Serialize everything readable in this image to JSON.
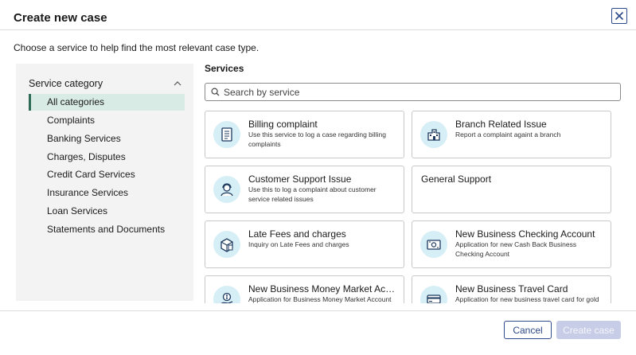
{
  "dialog": {
    "title": "Create new case",
    "subtitle": "Choose a service to help find the most relevant case type."
  },
  "sidebar": {
    "header": "Service category",
    "categories": [
      {
        "label": "All categories",
        "active": true
      },
      {
        "label": "Complaints"
      },
      {
        "label": "Banking Services"
      },
      {
        "label": "Charges, Disputes"
      },
      {
        "label": "Credit Card Services"
      },
      {
        "label": "Insurance Services"
      },
      {
        "label": "Loan Services"
      },
      {
        "label": "Statements and Documents"
      }
    ]
  },
  "services": {
    "label": "Services",
    "search_placeholder": "Search by service",
    "cards": [
      {
        "title": "Billing complaint",
        "desc": "Use this service to log a case regarding billing complaints",
        "icon": "document-icon"
      },
      {
        "title": "Branch Related Issue",
        "desc": "Report a complaint againt a branch",
        "icon": "building-icon"
      },
      {
        "title": "Customer Support Issue",
        "desc": "Use this to log a complaint about customer service related issues",
        "icon": "headset-agent-icon"
      },
      {
        "title": "General Support",
        "desc": "",
        "icon": ""
      },
      {
        "title": "Late Fees and charges",
        "desc": "Inquiry on Late Fees and charges",
        "icon": "fee-box-icon"
      },
      {
        "title": "New Business Checking Account",
        "desc": "Application for new Cash Back Business Checking Account",
        "icon": "money-bill-icon"
      },
      {
        "title": "New Business Money Market Acco...",
        "desc": "Application for Business Money Market Account",
        "icon": "coin-hand-icon"
      },
      {
        "title": "New Business Travel Card",
        "desc": "Application for new business travel card for gold",
        "icon": "card-icon"
      }
    ]
  },
  "footer": {
    "cancel_label": "Cancel",
    "create_label": "Create case"
  },
  "colors": {
    "accent": "#2d4a8a",
    "active_category_bg": "#d8ebe4",
    "active_category_bar": "#2e6b57",
    "icon_circle": "#d6eef6",
    "create_disabled": "#c7cde6"
  }
}
